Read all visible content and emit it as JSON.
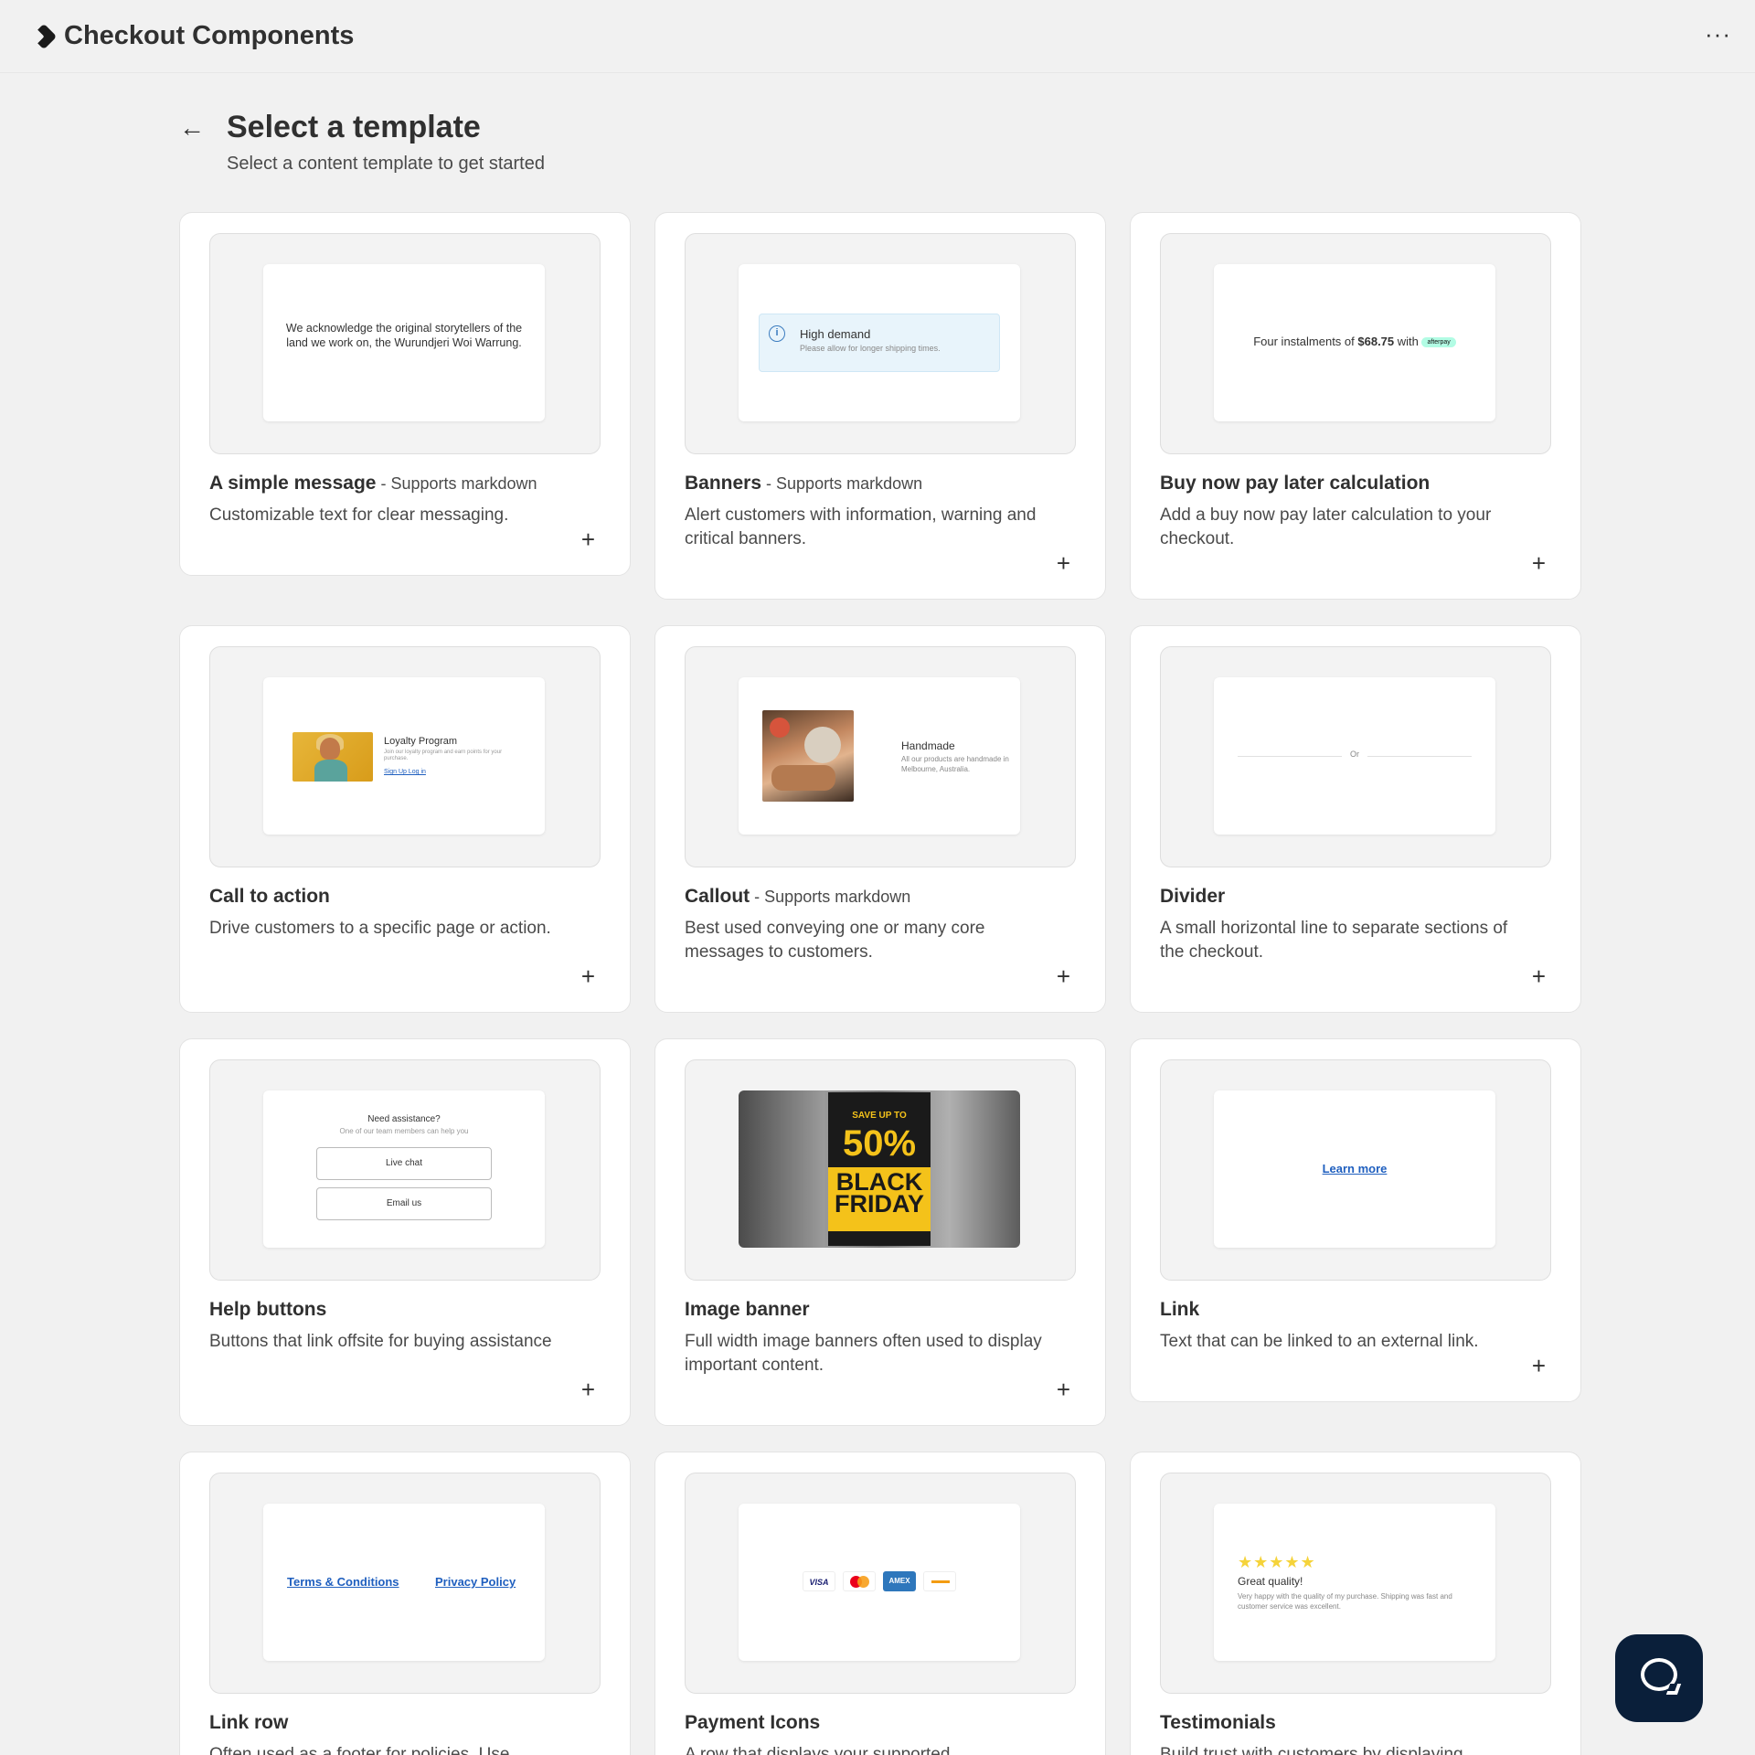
{
  "app": {
    "title": "Checkout Components",
    "more": "···"
  },
  "header": {
    "back": "←",
    "title": "Select a template",
    "subtitle": "Select a content template to get started"
  },
  "add_glyph": "+",
  "cards": {
    "simple_message": {
      "title": "A simple message",
      "tag": " - Supports markdown",
      "desc": "Customizable text for clear messaging.",
      "preview_text": "We acknowledge the original storytellers of the land we work on, the Wurundjeri Woi Warrung."
    },
    "banners": {
      "title": "Banners",
      "tag": " - Supports markdown",
      "desc": "Alert customers with information, warning and critical banners.",
      "preview_title": "High demand",
      "preview_sub": "Please allow for longer shipping times."
    },
    "bnpl": {
      "title": "Buy now pay later calculation",
      "desc": "Add a buy now pay later calculation to your checkout.",
      "preview_prefix": "Four instalments of ",
      "preview_amount": "$68.75",
      "preview_suffix": " with ",
      "preview_badge": "afterpay"
    },
    "cta": {
      "title": "Call to action",
      "desc": "Drive customers to a specific page or action.",
      "preview_title": "Loyalty Program",
      "preview_sub": "Join our loyalty program and earn points for your purchase.",
      "preview_links": "Sign Up  Log in"
    },
    "callout": {
      "title": "Callout",
      "tag": " - Supports markdown",
      "desc": "Best used conveying one or many core messages to customers.",
      "preview_title": "Handmade",
      "preview_sub": "All our products are handmade in Melbourne, Australia."
    },
    "divider": {
      "title": "Divider",
      "desc": "A small horizontal line to separate sections of the checkout.",
      "preview_text": "Or"
    },
    "help_buttons": {
      "title": "Help buttons",
      "desc": "Buttons that link offsite for buying assistance",
      "preview_title": "Need assistance?",
      "preview_sub": "One of our team members can help you",
      "btn1": "Live chat",
      "btn2": "Email us"
    },
    "image_banner": {
      "title": "Image banner",
      "desc": "Full width image banners often used to display important content.",
      "line1": "SAVE UP TO",
      "line2": "50%",
      "line3": "BLACK FRIDAY"
    },
    "link": {
      "title": "Link",
      "desc": "Text that can be linked to an external link.",
      "preview_text": "Learn more"
    },
    "link_row": {
      "title": "Link row",
      "desc": "Often used as a footer for policies. Use",
      "link1": "Terms & Conditions",
      "link2": "Privacy Policy"
    },
    "payment_icons": {
      "title": "Payment Icons",
      "desc": "A row that displays your supported",
      "visa": "VISA",
      "amex": "AMEX"
    },
    "testimonials": {
      "title": "Testimonials",
      "desc": "Build trust with customers by displaying",
      "stars": "★★★★★",
      "preview_title": "Great quality!",
      "preview_sub": "Very happy with the quality of my purchase. Shipping was fast and customer service was excellent."
    }
  }
}
